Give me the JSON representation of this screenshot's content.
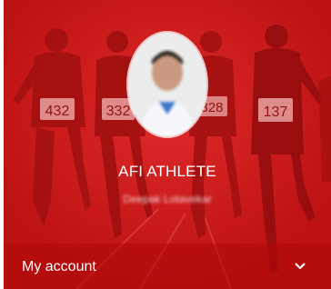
{
  "header": {
    "title": "AFI ATHLETE",
    "subtitle": "Deepak Lotavekar",
    "accent_color": "#d51a1a"
  },
  "bib_numbers": [
    "432",
    "332",
    "328",
    "137"
  ],
  "account": {
    "label": "My account",
    "expand_icon": "chevron-down-icon"
  }
}
